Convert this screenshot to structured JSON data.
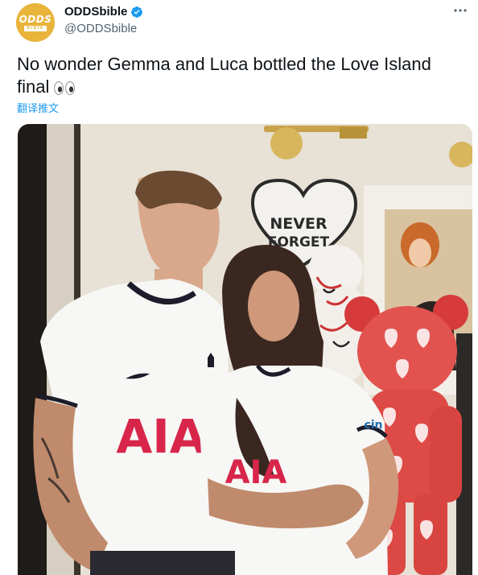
{
  "account": {
    "avatar_top": "ODDS",
    "avatar_bottom": "bible",
    "display_name": "ODDSbible",
    "handle": "@ODDSbible",
    "verified_icon": "verified-badge-icon",
    "more_icon": "more-options-icon"
  },
  "tweet": {
    "text": "No wonder Gemma and Luca bottled the Love Island final",
    "emoji": "eyes-emoji",
    "translate_label": "翻译推文"
  },
  "media": {
    "poster_line1": "NEVER",
    "poster_line2": "FORGET",
    "shirt_sponsor": "AIA",
    "sleeve_sponsor": "cin"
  },
  "colors": {
    "brand_gold": "#e9b43a",
    "link_blue": "#1d9bf0",
    "text_primary": "#0f1419",
    "text_secondary": "#536471"
  }
}
